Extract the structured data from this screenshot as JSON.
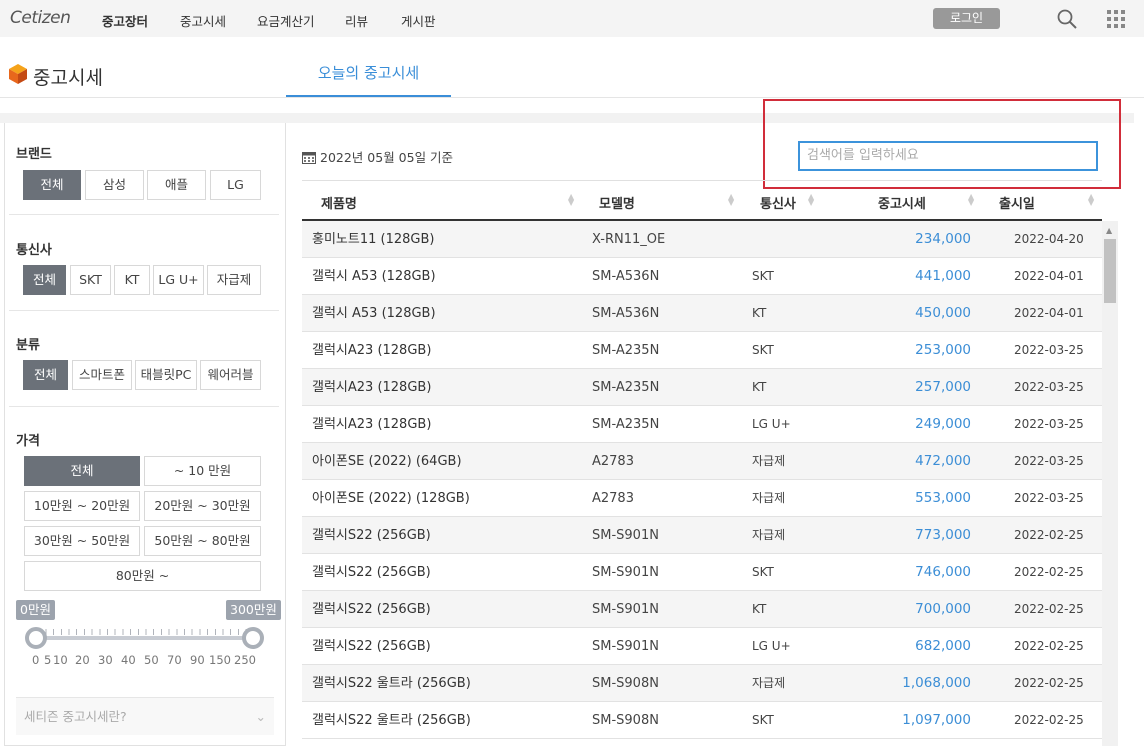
{
  "topbar": {
    "logo": "Cetizen",
    "nav": [
      "중고장터",
      "중고시세",
      "요금계산기",
      "리뷰",
      "게시판"
    ],
    "login": "로그인",
    "icons": [
      "search-icon",
      "apps-grid-icon"
    ]
  },
  "header": {
    "title": "중고시세",
    "tab": "오늘의 중고시세"
  },
  "filters": {
    "brand": {
      "title": "브랜드",
      "options": [
        "전체",
        "삼성",
        "애플",
        "LG"
      ],
      "selected": "전체"
    },
    "carrier": {
      "title": "통신사",
      "options": [
        "전체",
        "SKT",
        "KT",
        "LG U+",
        "자급제"
      ],
      "selected": "전체"
    },
    "category": {
      "title": "분류",
      "options": [
        "전체",
        "스마트폰",
        "태블릿PC",
        "웨어러블"
      ],
      "selected": "전체"
    },
    "price": {
      "title": "가격",
      "options": [
        "전체",
        "~ 10 만원",
        "10만원 ~ 20만원",
        "20만원 ~ 30만원",
        "30만원 ~ 50만원",
        "50만원 ~ 80만원",
        "80만원 ~"
      ],
      "selected": "전체",
      "range_min_label": "0만원",
      "range_max_label": "300만원",
      "ticks": [
        "0",
        "5",
        "10",
        "20",
        "30",
        "40",
        "50",
        "70",
        "90",
        "150",
        "250"
      ]
    },
    "info": "세티즌 중고시세란?"
  },
  "main": {
    "date": "2022년 05월 05일 기준",
    "search_placeholder": "검색어를 입력하세요",
    "columns": [
      "제품명",
      "모델명",
      "통신사",
      "중고시세",
      "출시일"
    ],
    "rows": [
      {
        "name": "홍미노트11 (128GB)",
        "model": "X-RN11_OE",
        "carrier": "",
        "price": "234,000",
        "date": "2022-04-20"
      },
      {
        "name": "갤럭시 A53 (128GB)",
        "model": "SM-A536N",
        "carrier": "SKT",
        "price": "441,000",
        "date": "2022-04-01"
      },
      {
        "name": "갤럭시 A53 (128GB)",
        "model": "SM-A536N",
        "carrier": "KT",
        "price": "450,000",
        "date": "2022-04-01"
      },
      {
        "name": "갤럭시A23 (128GB)",
        "model": "SM-A235N",
        "carrier": "SKT",
        "price": "253,000",
        "date": "2022-03-25"
      },
      {
        "name": "갤럭시A23 (128GB)",
        "model": "SM-A235N",
        "carrier": "KT",
        "price": "257,000",
        "date": "2022-03-25"
      },
      {
        "name": "갤럭시A23 (128GB)",
        "model": "SM-A235N",
        "carrier": "LG U+",
        "price": "249,000",
        "date": "2022-03-25"
      },
      {
        "name": "아이폰SE (2022) (64GB)",
        "model": "A2783",
        "carrier": "자급제",
        "price": "472,000",
        "date": "2022-03-25"
      },
      {
        "name": "아이폰SE (2022) (128GB)",
        "model": "A2783",
        "carrier": "자급제",
        "price": "553,000",
        "date": "2022-03-25"
      },
      {
        "name": "갤럭시S22 (256GB)",
        "model": "SM-S901N",
        "carrier": "자급제",
        "price": "773,000",
        "date": "2022-02-25"
      },
      {
        "name": "갤럭시S22 (256GB)",
        "model": "SM-S901N",
        "carrier": "SKT",
        "price": "746,000",
        "date": "2022-02-25"
      },
      {
        "name": "갤럭시S22 (256GB)",
        "model": "SM-S901N",
        "carrier": "KT",
        "price": "700,000",
        "date": "2022-02-25"
      },
      {
        "name": "갤럭시S22 (256GB)",
        "model": "SM-S901N",
        "carrier": "LG U+",
        "price": "682,000",
        "date": "2022-02-25"
      },
      {
        "name": "갤럭시S22 울트라 (256GB)",
        "model": "SM-S908N",
        "carrier": "자급제",
        "price": "1,068,000",
        "date": "2022-02-25"
      },
      {
        "name": "갤럭시S22 울트라 (256GB)",
        "model": "SM-S908N",
        "carrier": "SKT",
        "price": "1,097,000",
        "date": "2022-02-25"
      }
    ]
  },
  "colors": {
    "accent": "#3c8ed6",
    "selected": "#6b7179",
    "highlight_frame": "#d12d3a"
  }
}
